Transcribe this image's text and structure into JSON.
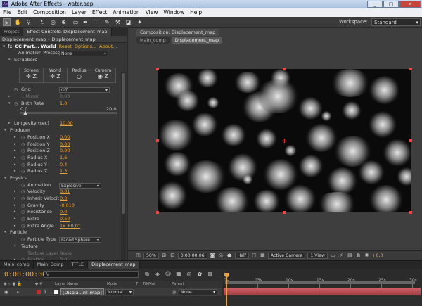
{
  "window": {
    "title": "Adobe After Effects - water.aep",
    "app_icon": "Ae",
    "controls": [
      "_",
      "□",
      "✕"
    ]
  },
  "menu": [
    "File",
    "Edit",
    "Composition",
    "Layer",
    "Effect",
    "Animation",
    "View",
    "Window",
    "Help"
  ],
  "toolbar": {
    "workspace_label": "Workspace:",
    "workspace_value": "Standard"
  },
  "left_panel": {
    "tabs": [
      "Project",
      "Effect Controls: Displacement_map"
    ],
    "header": "Displacement_map • Displacement_map",
    "effect": {
      "fx": "fx",
      "name": "CC Part... World",
      "reset": "Reset",
      "options": "Options...",
      "about": "About...",
      "presets_label": "Animation Presets:",
      "presets_value": "None"
    },
    "scrubbers": {
      "label": "Scrubbers",
      "cells": [
        {
          "label": "Screen",
          "sym": "✛ Z"
        },
        {
          "label": "World",
          "sym": "✛ Z"
        },
        {
          "label": "Radius",
          "sym": "○"
        },
        {
          "label": "Camera",
          "sym": "◉ Z"
        }
      ]
    },
    "grid": {
      "label": "Grid",
      "value": "Off"
    },
    "y_mirror": {
      "label": "...Mirror",
      "value": "0,00"
    },
    "birth_rate": {
      "label": "Birth Rate",
      "value": "1,0",
      "min": "0,0",
      "max": "20,0"
    },
    "longevity": {
      "label": "Longevity (sec)",
      "value": "10,00"
    },
    "producer": {
      "label": "Producer",
      "props": [
        {
          "label": "Position X",
          "value": "0,00"
        },
        {
          "label": "Position Y",
          "value": "0,00"
        },
        {
          "label": "Position Z",
          "value": "0,00"
        },
        {
          "label": "Radius X",
          "value": "1,6"
        },
        {
          "label": "Radius Y",
          "value": "0,4"
        },
        {
          "label": "Radius Z",
          "value": "1,3"
        }
      ]
    },
    "physics": {
      "label": "Physics",
      "animation_label": "Animation",
      "animation_value": "Explosive",
      "props": [
        {
          "label": "Velocity",
          "value": "0,01"
        },
        {
          "label": "Inherit Velocit",
          "value": "0,0"
        },
        {
          "label": "Gravity",
          "value": "-0,010"
        },
        {
          "label": "Resistance",
          "value": "0,0"
        },
        {
          "label": "Extra",
          "value": "0,50"
        },
        {
          "label": "Extra Angle",
          "value": "1x +0,0°"
        }
      ]
    },
    "particle": {
      "label": "Particle",
      "type_label": "Particle Type",
      "type_value": "Faded Sphere",
      "texture_label": "Texture",
      "texture_layer_label": "Texture Layer",
      "texture_layer_value": "None",
      "scatter_label": "Scatter",
      "scatter_value": "0,0"
    }
  },
  "composition": {
    "tab": "Composition: Displacement_map",
    "subtabs": [
      "Main_comp",
      "Displacement_map"
    ]
  },
  "viewer_bar": {
    "zoom": "50%",
    "timecode": "0:00:00:06",
    "resolution": "Half",
    "camera": "Active Camera",
    "views": "1 View",
    "exposure": "+0,0"
  },
  "timeline": {
    "tabs": [
      "Main_comp",
      "Main_Comp",
      "TITLE",
      "Displacement_map"
    ],
    "timecode": "0:00:00:06",
    "columns": [
      "Layer Name",
      "Mode",
      "T",
      "TrkMat",
      "Parent"
    ],
    "layer": {
      "index": "1",
      "name": "[Displa...nt_map]",
      "mode": "Normal",
      "parent": "None"
    },
    "ruler_ticks": [
      "0s",
      "05s",
      "10s",
      "15s",
      "20s",
      "25s",
      "30s"
    ]
  }
}
